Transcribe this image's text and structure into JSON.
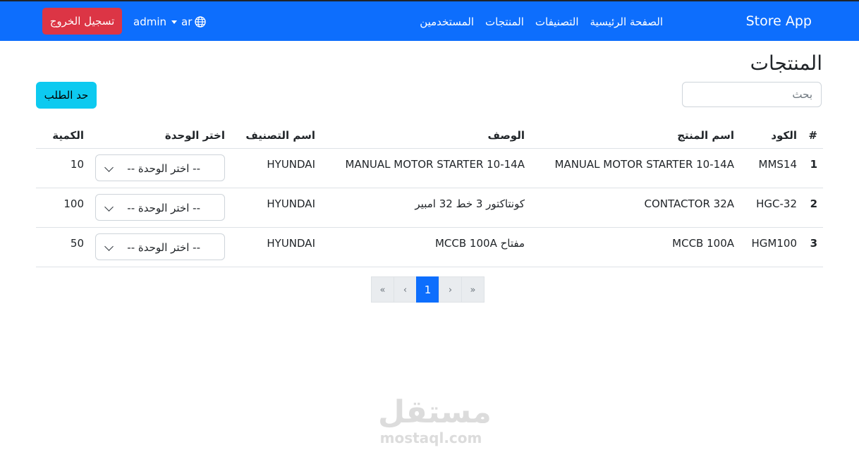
{
  "navbar": {
    "brand": "Store App",
    "links": [
      "الصفحة الرئيسية",
      "التصنيفات",
      "المنتجات",
      "المستخدمين"
    ],
    "user": "admin",
    "language": "ar",
    "logout_label": "تسجيل الخروج",
    "color": "#0d6efd"
  },
  "page": {
    "title": "المنتجات",
    "search_placeholder": "بحث",
    "limit_button_label": "حد الطلب"
  },
  "table": {
    "headers": [
      "#",
      "الكود",
      "اسم المنتج",
      "الوصف",
      "اسم التصنيف",
      "اختر الوحدة",
      "الكمية"
    ],
    "rows": [
      {
        "num": "1",
        "code": "MMS14",
        "name": "MANUAL MOTOR STARTER 10-14A",
        "description": "MANUAL MOTOR STARTER 10-14A",
        "category": "HYUNDAI",
        "unit": "-- اختر الوحدة --",
        "quantity": "10"
      },
      {
        "num": "2",
        "code": "HGC-32",
        "name": "CONTACTOR 32A",
        "description": "كونتاكتور 3 خط 32 امبير",
        "category": "HYUNDAI",
        "unit": "-- اختر الوحدة --",
        "quantity": "100"
      },
      {
        "num": "3",
        "code": "HGM100",
        "name": "MCCB 100A",
        "description": "مفتاح MCCB 100A",
        "category": "HYUNDAI",
        "unit": "-- اختر الوحدة --",
        "quantity": "50"
      }
    ]
  },
  "pagination": {
    "first": "«",
    "prev": "‹",
    "current": "1",
    "next": "›",
    "last": "»"
  },
  "watermark": {
    "arabic": "مستقل",
    "latin": "mostaql.com"
  }
}
